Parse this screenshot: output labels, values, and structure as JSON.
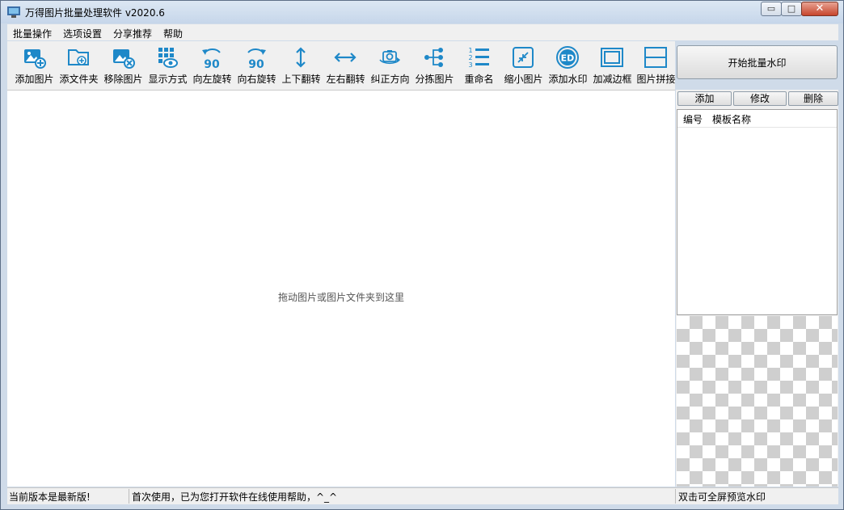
{
  "window": {
    "title": "万得图片批量处理软件 v2020.6",
    "min_glyph": "▭",
    "max_glyph": "□",
    "close_glyph": "✕"
  },
  "menu": [
    "批量操作",
    "选项设置",
    "分享推荐",
    "帮助"
  ],
  "toolbar": [
    {
      "label": "添加图片",
      "icon": "add-image-icon"
    },
    {
      "label": "添文件夹",
      "icon": "add-folder-icon"
    },
    {
      "label": "移除图片",
      "icon": "remove-image-icon"
    },
    {
      "label": "显示方式",
      "icon": "display-mode-icon"
    },
    {
      "label": "向左旋转",
      "icon": "rotate-left-icon"
    },
    {
      "label": "向右旋转",
      "icon": "rotate-right-icon"
    },
    {
      "label": "上下翻转",
      "icon": "flip-vertical-icon"
    },
    {
      "label": "左右翻转",
      "icon": "flip-horizontal-icon"
    },
    {
      "label": "纠正方向",
      "icon": "correct-orientation-icon"
    },
    {
      "label": "分拣图片",
      "icon": "sort-images-icon"
    },
    {
      "label": "重命名",
      "icon": "rename-icon"
    },
    {
      "label": "缩小图片",
      "icon": "shrink-image-icon"
    },
    {
      "label": "添加水印",
      "icon": "add-watermark-icon"
    },
    {
      "label": "加减边框",
      "icon": "border-icon"
    },
    {
      "label": "图片拼接",
      "icon": "stitch-images-icon"
    }
  ],
  "rotate_text": "90",
  "watermark_text": "ED",
  "start_button": "开始批量水印",
  "template_panel": {
    "add": "添加",
    "edit": "修改",
    "delete": "删除",
    "columns": [
      "编号",
      "模板名称"
    ]
  },
  "drop_hint": "拖动图片或图片文件夹到这里",
  "status": {
    "left": "当前版本是最新版!",
    "middle": "首次使用，已为您打开软件在线使用帮助，^_^",
    "right": "双击可全屏预览水印"
  },
  "colors": {
    "icon": "#1e88c8",
    "accent": "#4a9fd8"
  }
}
